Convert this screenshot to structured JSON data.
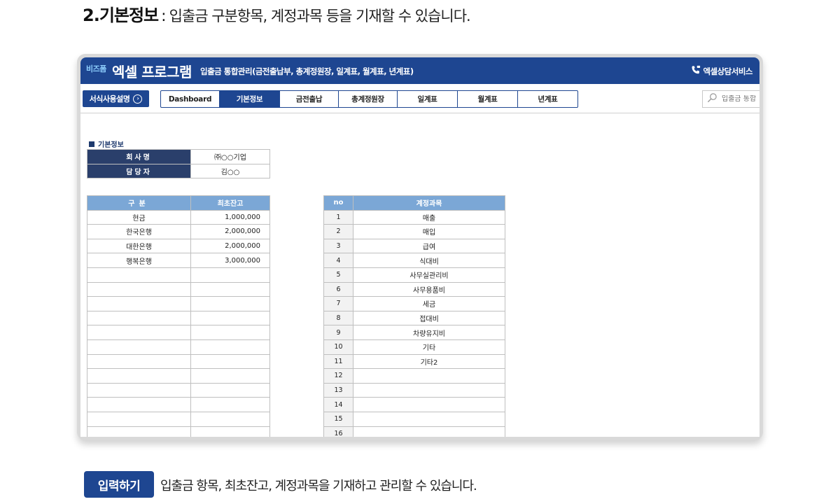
{
  "heading": {
    "number_title": "2.기본정보",
    "separator": ":",
    "description": "입출금 구분항목, 계정과목 등을 기재할 수 있습니다."
  },
  "window": {
    "brand_small": "비즈폼",
    "brand_big": "엑셀 프로그램",
    "subtitle": "입출금 통합관리(금전출납부, 총계정원장, 일계표, 월계표, 년계표)",
    "consult_label": "엑셀상담서비스"
  },
  "toolbar": {
    "guide_label": "서식사용설명",
    "tabs": [
      {
        "label": "Dashboard",
        "active": false
      },
      {
        "label": "기본정보",
        "active": true
      },
      {
        "label": "금전출납",
        "active": false
      },
      {
        "label": "총계정원장",
        "active": false
      },
      {
        "label": "일계표",
        "active": false
      },
      {
        "label": "월계표",
        "active": false
      },
      {
        "label": "년계표",
        "active": false
      }
    ],
    "search_placeholder": "입출금 통합"
  },
  "basic_info": {
    "section_title": "기본정보",
    "rows": [
      {
        "label": "회사명",
        "value": "㈜○○기업"
      },
      {
        "label": "담당자",
        "value": "김○○"
      }
    ]
  },
  "balance_table": {
    "headers": [
      "구분",
      "최초잔고"
    ],
    "rows": [
      [
        "현금",
        "1,000,000"
      ],
      [
        "한국은행",
        "2,000,000"
      ],
      [
        "대한은행",
        "2,000,000"
      ],
      [
        "행복은행",
        "3,000,000"
      ],
      [
        "",
        ""
      ],
      [
        "",
        ""
      ],
      [
        "",
        ""
      ],
      [
        "",
        ""
      ],
      [
        "",
        ""
      ],
      [
        "",
        ""
      ],
      [
        "",
        ""
      ],
      [
        "",
        ""
      ],
      [
        "",
        ""
      ],
      [
        "",
        ""
      ],
      [
        "",
        ""
      ],
      [
        "",
        ""
      ]
    ]
  },
  "account_table": {
    "headers": [
      "no",
      "계정과목"
    ],
    "rows": [
      [
        "1",
        "매출"
      ],
      [
        "2",
        "매입"
      ],
      [
        "3",
        "급여"
      ],
      [
        "4",
        "식대비"
      ],
      [
        "5",
        "사무실관리비"
      ],
      [
        "6",
        "사무용품비"
      ],
      [
        "7",
        "세금"
      ],
      [
        "8",
        "접대비"
      ],
      [
        "9",
        "차량유지비"
      ],
      [
        "10",
        "기타"
      ],
      [
        "11",
        "기타2"
      ],
      [
        "12",
        ""
      ],
      [
        "13",
        ""
      ],
      [
        "14",
        ""
      ],
      [
        "15",
        ""
      ],
      [
        "16",
        ""
      ]
    ]
  },
  "footer": {
    "badge": "입력하기",
    "description": "입출금 항목, 최초잔고, 계정과목을 기재하고 관리할 수 있습니다."
  },
  "colors": {
    "brand_navy": "#1e4691",
    "header_dark": "#2a3f6b",
    "header_light": "#7ba7d6",
    "no_col_bg": "#f2f2f2"
  }
}
